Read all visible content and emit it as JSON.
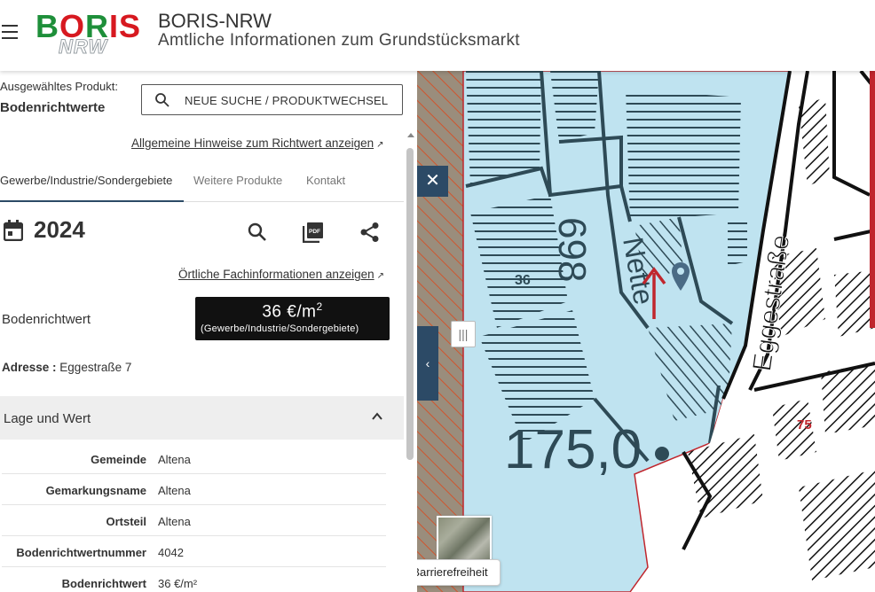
{
  "header": {
    "logo_main": "BORIS",
    "logo_sub": "NRW",
    "title": "BORIS-NRW",
    "subtitle": "Amtliche Informationen zum Grundstücksmarkt"
  },
  "sidebar": {
    "product_label": "Ausgewähltes Produkt:",
    "product_value": "Bodenrichtwerte",
    "search_button": "NEUE SUCHE / PRODUKTWECHSEL",
    "hint_link": "Allgemeine Hinweise zum Richtwert anzeigen",
    "tabs": [
      {
        "label": "Gewerbe/Industrie/Sondergebiete",
        "active": true
      },
      {
        "label": "Weitere Produkte",
        "active": false
      },
      {
        "label": "Kontakt",
        "active": false
      }
    ],
    "year": "2024",
    "fach_link": "Örtliche Fachinformationen anzeigen",
    "brw_label": "Bodenrichtwert",
    "brw_value": "36 €/m",
    "brw_unit_exp": "2",
    "brw_sub": "(Gewerbe/Industrie/Sondergebiete)",
    "address_label": "Adresse :",
    "address_value": "Eggestraße 7",
    "section_title": "Lage und Wert",
    "rows": [
      {
        "key": "Gemeinde",
        "value": "Altena"
      },
      {
        "key": "Gemarkungsname",
        "value": "Altena"
      },
      {
        "key": "Ortsteil",
        "value": "Altena"
      },
      {
        "key": "Bodenrichtwertnummer",
        "value": "4042"
      },
      {
        "key": "Bodenrichtwert",
        "value": "36 €/m²"
      }
    ]
  },
  "map": {
    "close_label": "✕",
    "collapse_label": "‹",
    "drag_label": "|||",
    "zone_label": "36",
    "parcel_label": "698",
    "street_label_1": "Nette",
    "street_label_2": "Eggestraße",
    "elevation_label": "175,0",
    "house_number": "75",
    "tooltip": "Barrierefreiheit"
  },
  "colors": {
    "accent": "#2c4a66",
    "zone_fill": "#bfe3f0",
    "parcel_stroke": "#2e4a56",
    "boundary_red": "#c0262d"
  }
}
